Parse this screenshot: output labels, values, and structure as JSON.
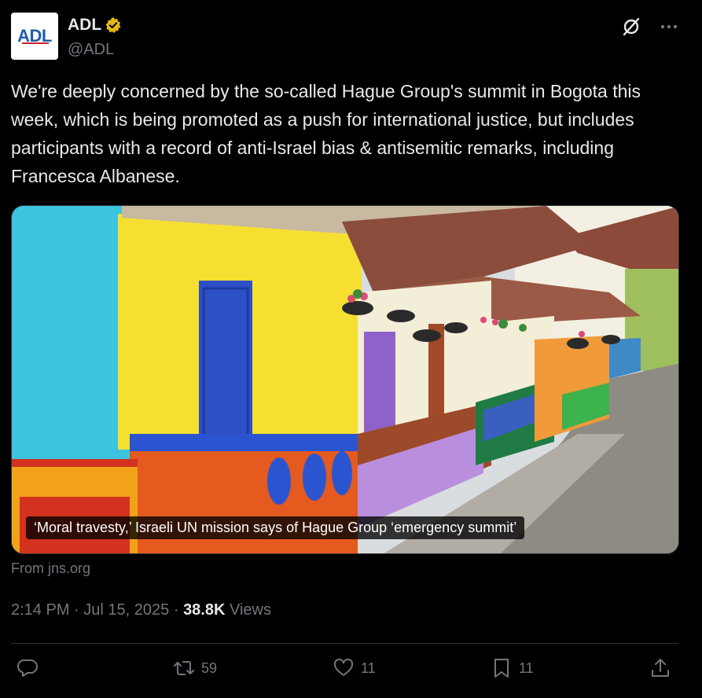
{
  "author": {
    "avatar_text": "ADL",
    "display_name": "ADL",
    "handle": "@ADL"
  },
  "tweet": {
    "text": "We're deeply concerned by the so-called Hague Group's summit in Bogota this week, which is being promoted as a push for international justice, but includes participants with a record of anti-Israel bias & antisemitic remarks, including Francesca Albanese."
  },
  "card": {
    "caption": "‘Moral travesty,’ Israeli UN mission says of Hague Group ‘emergency summit’",
    "source": "From jns.org"
  },
  "meta": {
    "time": "2:14 PM",
    "date": "Jul 15, 2025",
    "views_count": "38.8K",
    "views_label": "Views",
    "sep": "·"
  },
  "actions": {
    "reply_count": "",
    "repost_count": "59",
    "like_count": "11",
    "bookmark_count": "11"
  },
  "icons": {
    "verified": "verified-badge-icon",
    "grok": "grok-icon",
    "more": "more-icon",
    "reply": "reply-icon",
    "repost": "repost-icon",
    "like": "like-icon",
    "bookmark": "bookmark-icon",
    "share": "share-icon"
  },
  "colors": {
    "background": "#000000",
    "text": "#e7e9ea",
    "muted": "#71767b",
    "verified_gold": "#e2b719",
    "divider": "#2f3336"
  }
}
